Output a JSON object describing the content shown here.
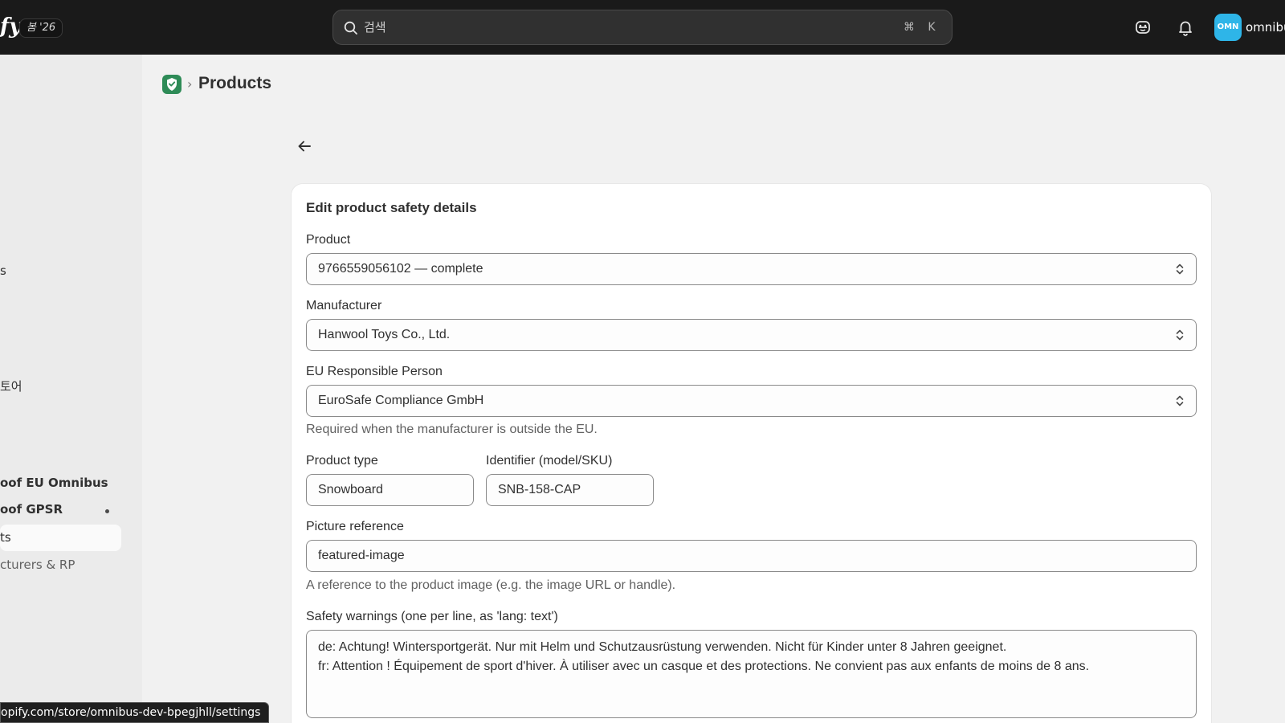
{
  "topbar": {
    "logo_fragment": "fy",
    "season_badge": "봄 '26",
    "search": {
      "placeholder": "검색",
      "shortcut_modifier": "⌘",
      "shortcut_key": "K"
    },
    "avatar_initials": "OMN",
    "store_name": "omnibu"
  },
  "sidebar": {
    "items": [
      {
        "label": "s"
      },
      {
        "label": "토어"
      },
      {
        "label": "oof EU Omnibus"
      },
      {
        "label": "oof GPSR"
      },
      {
        "label": "ts"
      },
      {
        "label": "cturers & RP"
      }
    ]
  },
  "status_bar": {
    "url": "opify.com/store/omnibus-dev-bpegjhll/settings"
  },
  "header": {
    "title": "Products"
  },
  "form": {
    "title": "Edit product safety details",
    "product": {
      "label": "Product",
      "value": "9766559056102 — complete"
    },
    "manufacturer": {
      "label": "Manufacturer",
      "value": "Hanwool Toys Co., Ltd."
    },
    "eu_rp": {
      "label": "EU Responsible Person",
      "value": "EuroSafe Compliance GmbH",
      "help": "Required when the manufacturer is outside the EU."
    },
    "product_type": {
      "label": "Product type",
      "value": "Snowboard"
    },
    "identifier": {
      "label": "Identifier (model/SKU)",
      "value": "SNB-158-CAP"
    },
    "picture_ref": {
      "label": "Picture reference",
      "value": "featured-image",
      "help": "A reference to the product image (e.g. the image URL or handle)."
    },
    "warnings": {
      "label": "Safety warnings (one per line, as 'lang: text')",
      "lines": [
        "de: Achtung! Wintersportgerät. Nur mit Helm und Schutzausrüstung verwenden. Nicht für Kinder unter 8 Jahren geeignet.",
        "fr: Attention ! Équipement de sport d'hiver. À utiliser avec un casque et des protections. Ne convient pas aux enfants de moins de 8 ans."
      ]
    }
  },
  "colors": {
    "topbar": "#1a1a1a",
    "avatar": "#2eb5e8",
    "app_icon": "#2e8b57",
    "page_bg": "#f1f1f1"
  }
}
